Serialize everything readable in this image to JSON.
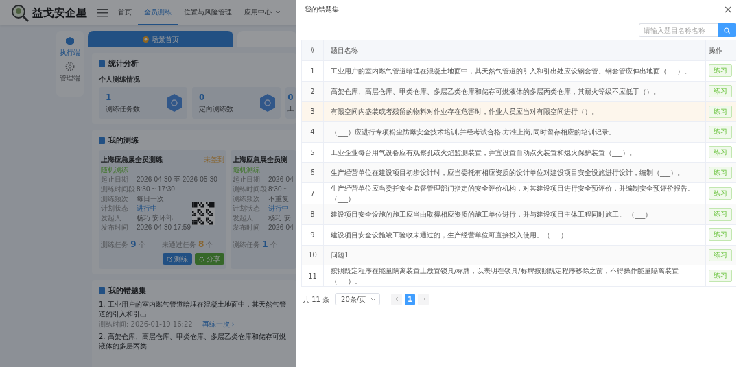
{
  "app": {
    "logo_text": "益戈安企星",
    "nav": [
      {
        "label": "首页",
        "selected": false,
        "dropdown": false
      },
      {
        "label": "全员测练",
        "selected": true,
        "dropdown": false
      },
      {
        "label": "位置与风险管理",
        "selected": false,
        "dropdown": false
      },
      {
        "label": "应用中心",
        "selected": false,
        "dropdown": true
      }
    ],
    "side_rail": [
      {
        "label": "执行端",
        "selected": true,
        "kind": "cube"
      },
      {
        "label": "管理端",
        "selected": false,
        "kind": "gear"
      }
    ],
    "tabs": [
      {
        "label": "场景首页",
        "selected": true
      }
    ],
    "stats": {
      "title": "统计分析",
      "subtitle": "个人测练情况",
      "tiles": [
        {
          "value": "1",
          "label": "测练任务数"
        },
        {
          "value": "0",
          "label": "定向测练数"
        },
        {
          "value": "0",
          "label": "工"
        }
      ]
    },
    "drills": {
      "title": "我的测练",
      "cards": [
        {
          "title": "上海应急展全员测练",
          "badge": "未签到",
          "tag": "随机测练",
          "fields": [
            {
              "label": "起止日期",
              "value": "2026-04-30 至 2026-05-30",
              "kind": "plain"
            },
            {
              "label": "测练时间段",
              "value": "8:30 ~ 17:30",
              "kind": "plain"
            },
            {
              "label": "测练频次",
              "value": "每日一次",
              "kind": "plain"
            },
            {
              "label": "计划状态",
              "value": "进行中",
              "kind": "status"
            },
            {
              "label": "发起人",
              "value": "杨巧 安环部",
              "kind": "plain"
            },
            {
              "label": "发布时间",
              "value": "2026-04-30 17:59",
              "kind": "plain"
            }
          ],
          "counts": [
            {
              "label": "测练任务",
              "count": "9",
              "unit": "个",
              "kind": "total"
            },
            {
              "label": "未通过任务",
              "count": "8",
              "unit": "个",
              "kind": "failed"
            }
          ],
          "qr": true,
          "buttons": [
            {
              "label": "测练",
              "kind": "primary"
            },
            {
              "label": "分享",
              "kind": "success"
            }
          ]
        },
        {
          "title": "上海应急展全员测",
          "tag": "随机测练",
          "fields": [
            {
              "label": "起止日期",
              "value": "2026-04",
              "kind": "plain"
            },
            {
              "label": "测练时间段",
              "value": "8:30 ~",
              "kind": "plain"
            },
            {
              "label": "测练频次",
              "value": "不重复",
              "kind": "plain"
            },
            {
              "label": "计划状态",
              "value": "进行中",
              "kind": "status"
            },
            {
              "label": "发起人",
              "value": "杨巧 安",
              "kind": "plain"
            },
            {
              "label": "发布时间",
              "value": "2026-04",
              "kind": "plain"
            }
          ],
          "counts": [
            {
              "label": "测练任务",
              "count": "1",
              "unit": "个",
              "kind": "total"
            }
          ],
          "qr": false
        }
      ]
    },
    "mistakes": {
      "title": "我的错题集",
      "items": [
        {
          "text": "1. 工业用户的室内燃气管道暗埋在混凝土地面中，其天然气管道的引入和引出",
          "time": "测练时间: 2026-01-19 16:22",
          "link": "再练一次 ›"
        },
        {
          "text": "2. 高架仓库、高层仓库、甲类仓库、多层乙类仓库和储存可燃液体的多层丙类"
        }
      ]
    }
  },
  "drawer": {
    "title": "我的错题集",
    "close": "×",
    "search": {
      "placeholder": "请输入题目名称名称"
    },
    "columns": [
      "#",
      "题目名称",
      "操作"
    ],
    "rows": [
      {
        "index": "1",
        "question": "工业用户的室内燃气管道暗埋在混凝土地面中，其天然气管道的引入和引出处应设钢套管。钢套管应伸出地面（___）。",
        "action": "练习",
        "highlighted": false
      },
      {
        "index": "2",
        "question": "高架仓库、高层仓库、甲类仓库、多层乙类仓库和储存可燃液体的多层丙类仓库，其耐火等级不应低于（）。",
        "action": "练习",
        "highlighted": false
      },
      {
        "index": "3",
        "question": "有限空间内盛装或者残留的物料对作业存在危害时，作业人员应当对有限空间进行（）。",
        "action": "练习",
        "highlighted": true
      },
      {
        "index": "4",
        "question": "（___）应进行专项粉尘防爆安全技术培训,并经考试合格,方准上岗,同时留存相应的培训记录。",
        "action": "练习",
        "highlighted": false
      },
      {
        "index": "5",
        "question": "工业企业每台用气设备应有观察孔或火焰监测装置，并宜设置自动点火装置和熄火保护装置（___）。",
        "action": "练习",
        "highlighted": false
      },
      {
        "index": "6",
        "question": "生产经营单位在建设项目初步设计时，应当委托有相应资质的设计单位对建设项目安全设施进行设计，编制（___）。",
        "action": "练习",
        "highlighted": false
      },
      {
        "index": "7",
        "question": "生产经营单位应当委托安全监督管理部门指定的安全评价机构，对其建设项目进行安全预评价，并编制安全预评价报告。（___）",
        "action": "练习",
        "highlighted": false
      },
      {
        "index": "8",
        "question": "建设项目安全设施的施工应当由取得相应资质的施工单位进行，并与建设项目主体工程同时施工。 （___）",
        "action": "练习",
        "highlighted": false
      },
      {
        "index": "9",
        "question": "建设项目安全设施竣工验收未通过的，生产经营单位可直接投入使用。（___）",
        "action": "练习",
        "highlighted": false
      },
      {
        "index": "10",
        "question": "问题1",
        "action": "练习",
        "highlighted": false
      },
      {
        "index": "11",
        "question": "按照既定程序在能量隔离装置上放置锁具/标牌，以表明在锁具/标牌按照既定程序移除之前，不得操作能量隔离装置（___）。",
        "action": "练习",
        "highlighted": false
      }
    ],
    "pagination": {
      "total": "共 11 条",
      "page_size": "20条/页",
      "pages": [
        {
          "label": "1",
          "selected": true
        }
      ]
    }
  }
}
